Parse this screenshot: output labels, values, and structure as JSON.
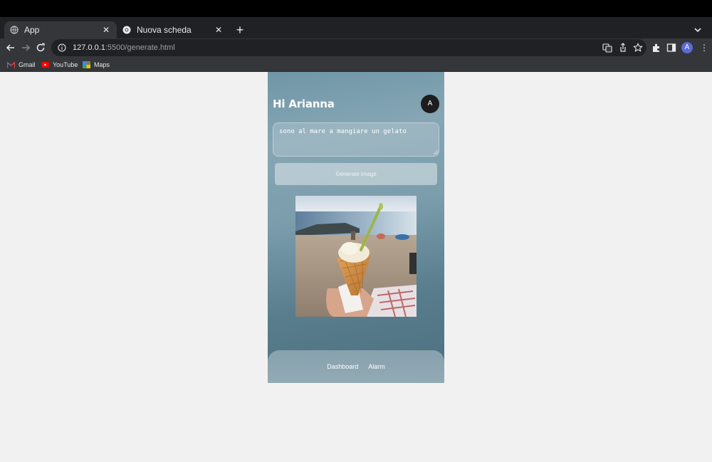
{
  "browser": {
    "tabs": [
      {
        "title": "App",
        "active": true,
        "favicon": "globe-icon"
      },
      {
        "title": "Nuova scheda",
        "active": false,
        "favicon": "chrome-icon"
      }
    ],
    "new_tab": "+",
    "address": {
      "host": "127.0.0.1",
      "rest": ":5500/generate.html"
    },
    "profile_initial": "A",
    "bookmarks": [
      {
        "label": "Gmail",
        "icon": "gmail-icon"
      },
      {
        "label": "YouTube",
        "icon": "youtube-icon"
      },
      {
        "label": "Maps",
        "icon": "maps-icon"
      }
    ]
  },
  "app": {
    "greeting": "Hi Arianna",
    "avatar_initial": "A",
    "prompt_value": "sono al mare a mangiare un gelato",
    "generate_label": "Generate image",
    "nav": [
      "Dashboard",
      "Alarm"
    ]
  },
  "colors": {
    "accent": "#6f96a7",
    "avatar_bg": "#1d1d1d"
  }
}
